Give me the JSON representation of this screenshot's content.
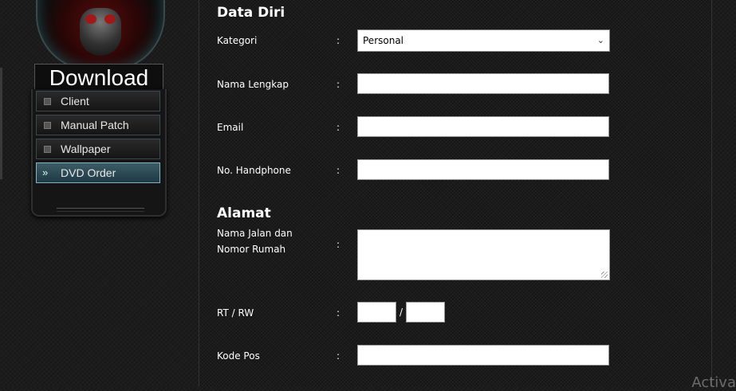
{
  "sidebar": {
    "title": "Download",
    "items": [
      {
        "label": "Client"
      },
      {
        "label": "Manual Patch"
      },
      {
        "label": "Wallpaper"
      },
      {
        "label": "DVD Order",
        "active": true
      }
    ]
  },
  "form": {
    "section_personal": "Data Diri",
    "kategori": {
      "label": "Kategori",
      "value": "Personal"
    },
    "nama_lengkap": {
      "label": "Nama Lengkap",
      "value": ""
    },
    "email": {
      "label": "Email",
      "value": ""
    },
    "handphone": {
      "label": "No. Handphone",
      "value": ""
    },
    "section_address": "Alamat",
    "jalan": {
      "label_line1": "Nama Jalan dan",
      "label_line2": "Nomor Rumah",
      "value": ""
    },
    "rtrw": {
      "label": "RT / RW",
      "separator": "/",
      "rt_value": "",
      "rw_value": ""
    },
    "kode_pos": {
      "label": "Kode Pos",
      "value": ""
    },
    "colon": ":"
  },
  "watermark": "Activa",
  "colors": {
    "accent": "#7fb5c5",
    "background": "#1c1c1c",
    "field": "#ffffff"
  }
}
